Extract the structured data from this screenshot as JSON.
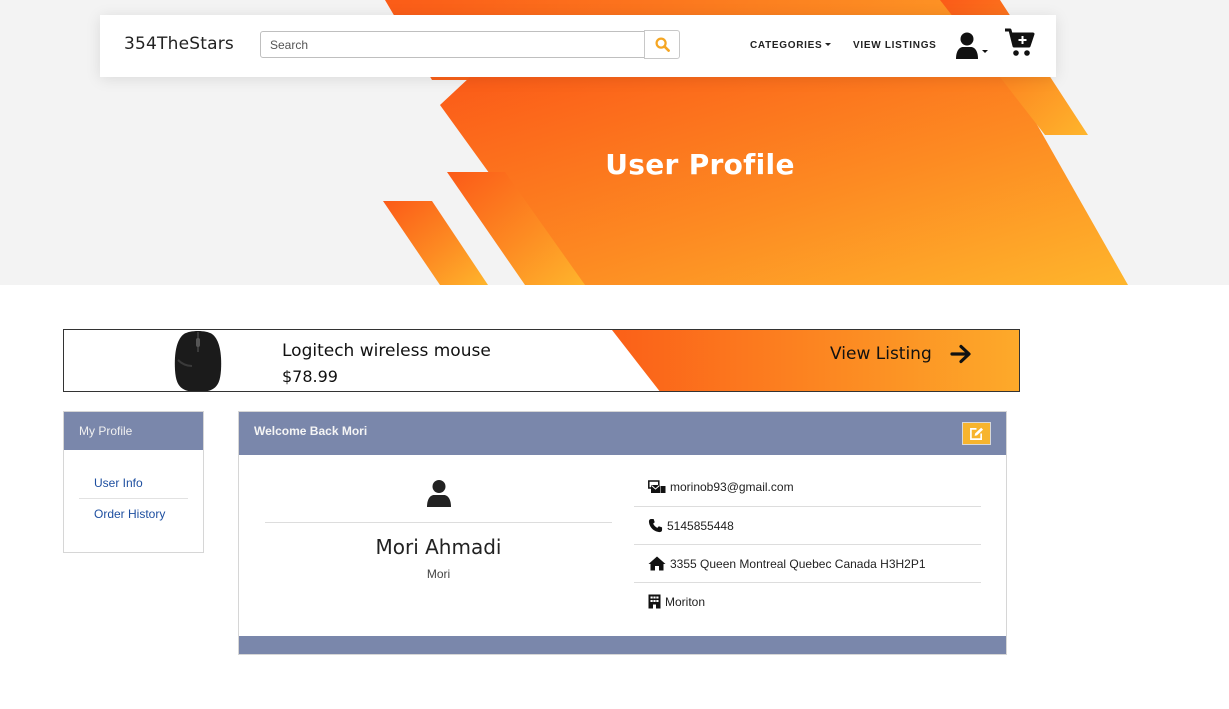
{
  "navbar": {
    "brand": "354TheStars",
    "search_placeholder": "Search",
    "search_value": "",
    "categories_label": "CATEGORIES",
    "view_listings_label": "VIEW LISTINGS",
    "icons": {
      "search": "search-icon",
      "user": "user-icon",
      "cart": "cart-plus-icon"
    }
  },
  "hero": {
    "title": "User Profile"
  },
  "banner": {
    "product_name": "Logitech wireless mouse",
    "price": "$78.99",
    "cta_label": "View Listing",
    "icons": {
      "cta": "arrow-right-icon",
      "product": "mouse-image"
    }
  },
  "sidebar": {
    "title": "My Profile",
    "items": [
      {
        "label": "User Info"
      },
      {
        "label": "Order History"
      }
    ]
  },
  "profile": {
    "welcome": "Welcome Back Mori",
    "full_name": "Mori Ahmadi",
    "username": "Mori",
    "email": "morinob93@gmail.com",
    "phone": "5145855448",
    "address": "3355 Queen Montreal Quebec Canada H3H2P1",
    "company": "Moriton",
    "icons": {
      "edit": "edit-icon",
      "avatar": "user-icon",
      "email": "mail-bulk-icon",
      "phone": "phone-icon",
      "address": "home-icon",
      "company": "building-icon"
    }
  },
  "colors": {
    "accent_orange": "#fb6a1b",
    "accent_yellow": "#fdb02e",
    "card_header": "#7a87ab",
    "edit_button": "#f7b42d",
    "link": "#1e4fa0"
  }
}
